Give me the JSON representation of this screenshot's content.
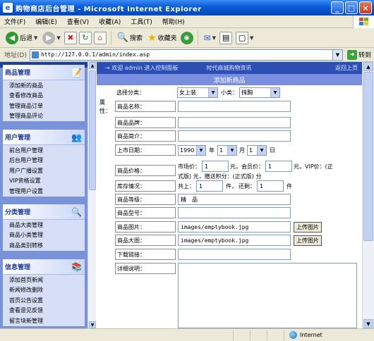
{
  "window": {
    "title": "购物商店后台管理 - Microsoft Internet Explorer",
    "buttons": [
      "_",
      "□",
      "×"
    ]
  },
  "menu": [
    "文件(F)",
    "编辑(E)",
    "查看(V)",
    "收藏(A)",
    "工具(T)",
    "帮助(H)"
  ],
  "toolbar": {
    "back": "后退",
    "search": "搜索",
    "favorites": "收藏夹"
  },
  "address": {
    "label": "地址(D)",
    "url": "http://127.0.0.1/admin/index.asp",
    "go": "转到"
  },
  "sidebar": {
    "groups": [
      {
        "title": "商品管理",
        "items": [
          "添加新的商品",
          "查看修改商品",
          "管理商品订单",
          "管理商品评论"
        ]
      },
      {
        "title": "用户管理",
        "items": [
          "前台用户管理",
          "后台用户管理",
          "用户广播设置",
          "VIP资格设置",
          "管理用户设置"
        ]
      },
      {
        "title": "分类管理",
        "items": [
          "商品大类管理",
          "商品小类管理",
          "商品类别转移"
        ]
      },
      {
        "title": "信息管理",
        "items": [
          "添加首页新闻",
          "新闻修改删除",
          "首页公告设置",
          "查看意见反馈",
          "留言块新管理"
        ]
      }
    ]
  },
  "main": {
    "topstrip": {
      "welcome": "→ 欢迎 admin 进入控制面板",
      "news": "时代商城购物资讯",
      "right": "返回上页"
    },
    "form_title": "添加新商品",
    "attr_label": "属性：",
    "category_label": "选择分类：",
    "category_value": "女上装",
    "subcategory_label": "小类：",
    "subcategory_value": "抹胸",
    "fields": {
      "name": "商品名称：",
      "brand": "商品品牌：",
      "intro": "商品简介：",
      "date": "上市日期：",
      "year": "1990",
      "year_unit": "年",
      "month": "1",
      "month_unit": "月",
      "day": "1",
      "day_unit": "日",
      "price": "商品价格：",
      "market_price": "市场价：",
      "market_value": "1",
      "yuan1": "元，",
      "member_price": "会员价：",
      "member_value": "1",
      "yuan2": "元，",
      "vip_price": "VIP价：(正",
      "price_line2": "式版) 元，赠送积分：(正式版) 分",
      "stock": "库存情况：",
      "stock_total_label": "共上：",
      "stock_total": "1",
      "stock_unit1": "件，",
      "stock_left_label": "还剩：",
      "stock_left": "1",
      "stock_unit2": "件",
      "level": "商品等级：",
      "level_value": "精　品",
      "model": "商品型号：",
      "image": "商品图片：",
      "image_value": "images/emptybook.jpg",
      "upload": "上传图片",
      "big_image": "商品大图：",
      "big_image_value": "images/emptybook.jpg",
      "download": "下载链接：",
      "desc": "详细说明："
    }
  },
  "status": {
    "zone": "Internet"
  },
  "colors": {
    "title_bar": "#0a5ad8",
    "sidebar": "#7a93d8",
    "form_header": "#7a8ee0"
  }
}
